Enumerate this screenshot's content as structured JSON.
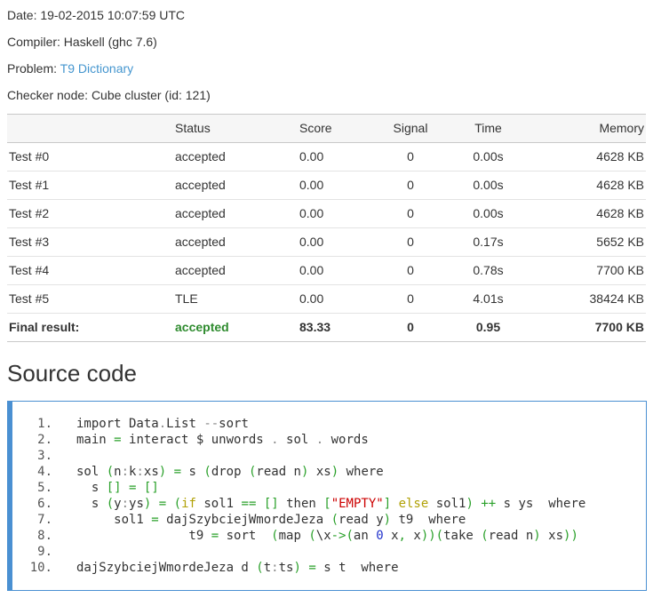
{
  "meta": {
    "date": "Date: 19-02-2015 10:07:59 UTC",
    "compiler": "Compiler: Haskell (ghc 7.6)",
    "problem_label": "Problem: ",
    "problem_link": "T9 Dictionary",
    "checker": "Checker node: Cube cluster (id: 121)"
  },
  "table": {
    "headers": [
      "",
      "Status",
      "Score",
      "Signal",
      "Time",
      "Memory"
    ],
    "rows": [
      {
        "name": "Test #0",
        "status": "accepted",
        "score": "0.00",
        "signal": "0",
        "time": "0.00s",
        "memory": "4628 KB"
      },
      {
        "name": "Test #1",
        "status": "accepted",
        "score": "0.00",
        "signal": "0",
        "time": "0.00s",
        "memory": "4628 KB"
      },
      {
        "name": "Test #2",
        "status": "accepted",
        "score": "0.00",
        "signal": "0",
        "time": "0.00s",
        "memory": "4628 KB"
      },
      {
        "name": "Test #3",
        "status": "accepted",
        "score": "0.00",
        "signal": "0",
        "time": "0.17s",
        "memory": "5652 KB"
      },
      {
        "name": "Test #4",
        "status": "accepted",
        "score": "0.00",
        "signal": "0",
        "time": "0.78s",
        "memory": "7700 KB"
      },
      {
        "name": "Test #5",
        "status": "TLE",
        "score": "0.00",
        "signal": "0",
        "time": "4.01s",
        "memory": "38424 KB"
      }
    ],
    "final": {
      "name": "Final result:",
      "status": "accepted",
      "score": "83.33",
      "signal": "0",
      "time": "0.95",
      "memory": "7700 KB"
    }
  },
  "source": {
    "heading": "Source code",
    "lines": [
      [
        [
          "t",
          "import Data"
        ],
        [
          "g",
          "."
        ],
        [
          "t",
          "List "
        ],
        [
          "g",
          "--"
        ],
        [
          "t",
          "sort"
        ]
      ],
      [
        [
          "t",
          "main "
        ],
        [
          "o",
          "="
        ],
        [
          "t",
          " interact $ unwords "
        ],
        [
          "g",
          "."
        ],
        [
          "t",
          " sol "
        ],
        [
          "g",
          "."
        ],
        [
          "t",
          " words"
        ]
      ],
      [],
      [
        [
          "t",
          "sol "
        ],
        [
          "o",
          "("
        ],
        [
          "t",
          "n"
        ],
        [
          "g",
          ":"
        ],
        [
          "t",
          "k"
        ],
        [
          "g",
          ":"
        ],
        [
          "t",
          "xs"
        ],
        [
          "o",
          ")"
        ],
        [
          "t",
          " "
        ],
        [
          "o",
          "="
        ],
        [
          "t",
          " s "
        ],
        [
          "o",
          "("
        ],
        [
          "t",
          "drop "
        ],
        [
          "o",
          "("
        ],
        [
          "t",
          "read n"
        ],
        [
          "o",
          ")"
        ],
        [
          "t",
          " xs"
        ],
        [
          "o",
          ")"
        ],
        [
          "t",
          " where"
        ]
      ],
      [
        [
          "t",
          "  s "
        ],
        [
          "o",
          "[]"
        ],
        [
          "t",
          " "
        ],
        [
          "o",
          "="
        ],
        [
          "t",
          " "
        ],
        [
          "o",
          "[]"
        ]
      ],
      [
        [
          "t",
          "  s "
        ],
        [
          "o",
          "("
        ],
        [
          "t",
          "y"
        ],
        [
          "g",
          ":"
        ],
        [
          "t",
          "ys"
        ],
        [
          "o",
          ")"
        ],
        [
          "t",
          " "
        ],
        [
          "o",
          "="
        ],
        [
          "t",
          " "
        ],
        [
          "o",
          "("
        ],
        [
          "k",
          "if"
        ],
        [
          "t",
          " sol1 "
        ],
        [
          "o",
          "=="
        ],
        [
          "t",
          " "
        ],
        [
          "o",
          "[]"
        ],
        [
          "t",
          " then "
        ],
        [
          "o",
          "["
        ],
        [
          "s",
          "\"EMPTY\""
        ],
        [
          "o",
          "]"
        ],
        [
          "t",
          " "
        ],
        [
          "k",
          "else"
        ],
        [
          "t",
          " sol1"
        ],
        [
          "o",
          ")"
        ],
        [
          "t",
          " "
        ],
        [
          "o",
          "++"
        ],
        [
          "t",
          " s ys  where"
        ]
      ],
      [
        [
          "t",
          "     sol1 "
        ],
        [
          "o",
          "="
        ],
        [
          "t",
          " dajSzybciejWmordeJeza "
        ],
        [
          "o",
          "("
        ],
        [
          "t",
          "read y"
        ],
        [
          "o",
          ")"
        ],
        [
          "t",
          " t9  where"
        ]
      ],
      [
        [
          "t",
          "               t9 "
        ],
        [
          "o",
          "="
        ],
        [
          "t",
          " sort  "
        ],
        [
          "o",
          "("
        ],
        [
          "t",
          "map "
        ],
        [
          "o",
          "("
        ],
        [
          "t",
          "\\x"
        ],
        [
          "o",
          "->"
        ],
        [
          "o",
          "("
        ],
        [
          "t",
          "an "
        ],
        [
          "n",
          "0"
        ],
        [
          "t",
          " x"
        ],
        [
          "o",
          ","
        ],
        [
          "t",
          " x"
        ],
        [
          "o",
          "))"
        ],
        [
          "o",
          "("
        ],
        [
          "t",
          "take "
        ],
        [
          "o",
          "("
        ],
        [
          "t",
          "read n"
        ],
        [
          "o",
          ")"
        ],
        [
          "t",
          " xs"
        ],
        [
          "o",
          "))"
        ]
      ],
      [],
      [
        [
          "t",
          "dajSzybciejWmordeJeza d "
        ],
        [
          "o",
          "("
        ],
        [
          "t",
          "t"
        ],
        [
          "g",
          ":"
        ],
        [
          "t",
          "ts"
        ],
        [
          "o",
          ")"
        ],
        [
          "t",
          " "
        ],
        [
          "o",
          "="
        ],
        [
          "t",
          " s t  where"
        ]
      ]
    ]
  },
  "colors": {
    "link": "#4596cf",
    "final_accepted": "#2e8b2e",
    "code_border": "#4a90d2",
    "token_operator": "#2aa02a",
    "token_keyword": "#b1a106",
    "token_string": "#cc0000",
    "token_number": "#2233cc",
    "token_gray": "#888888"
  }
}
